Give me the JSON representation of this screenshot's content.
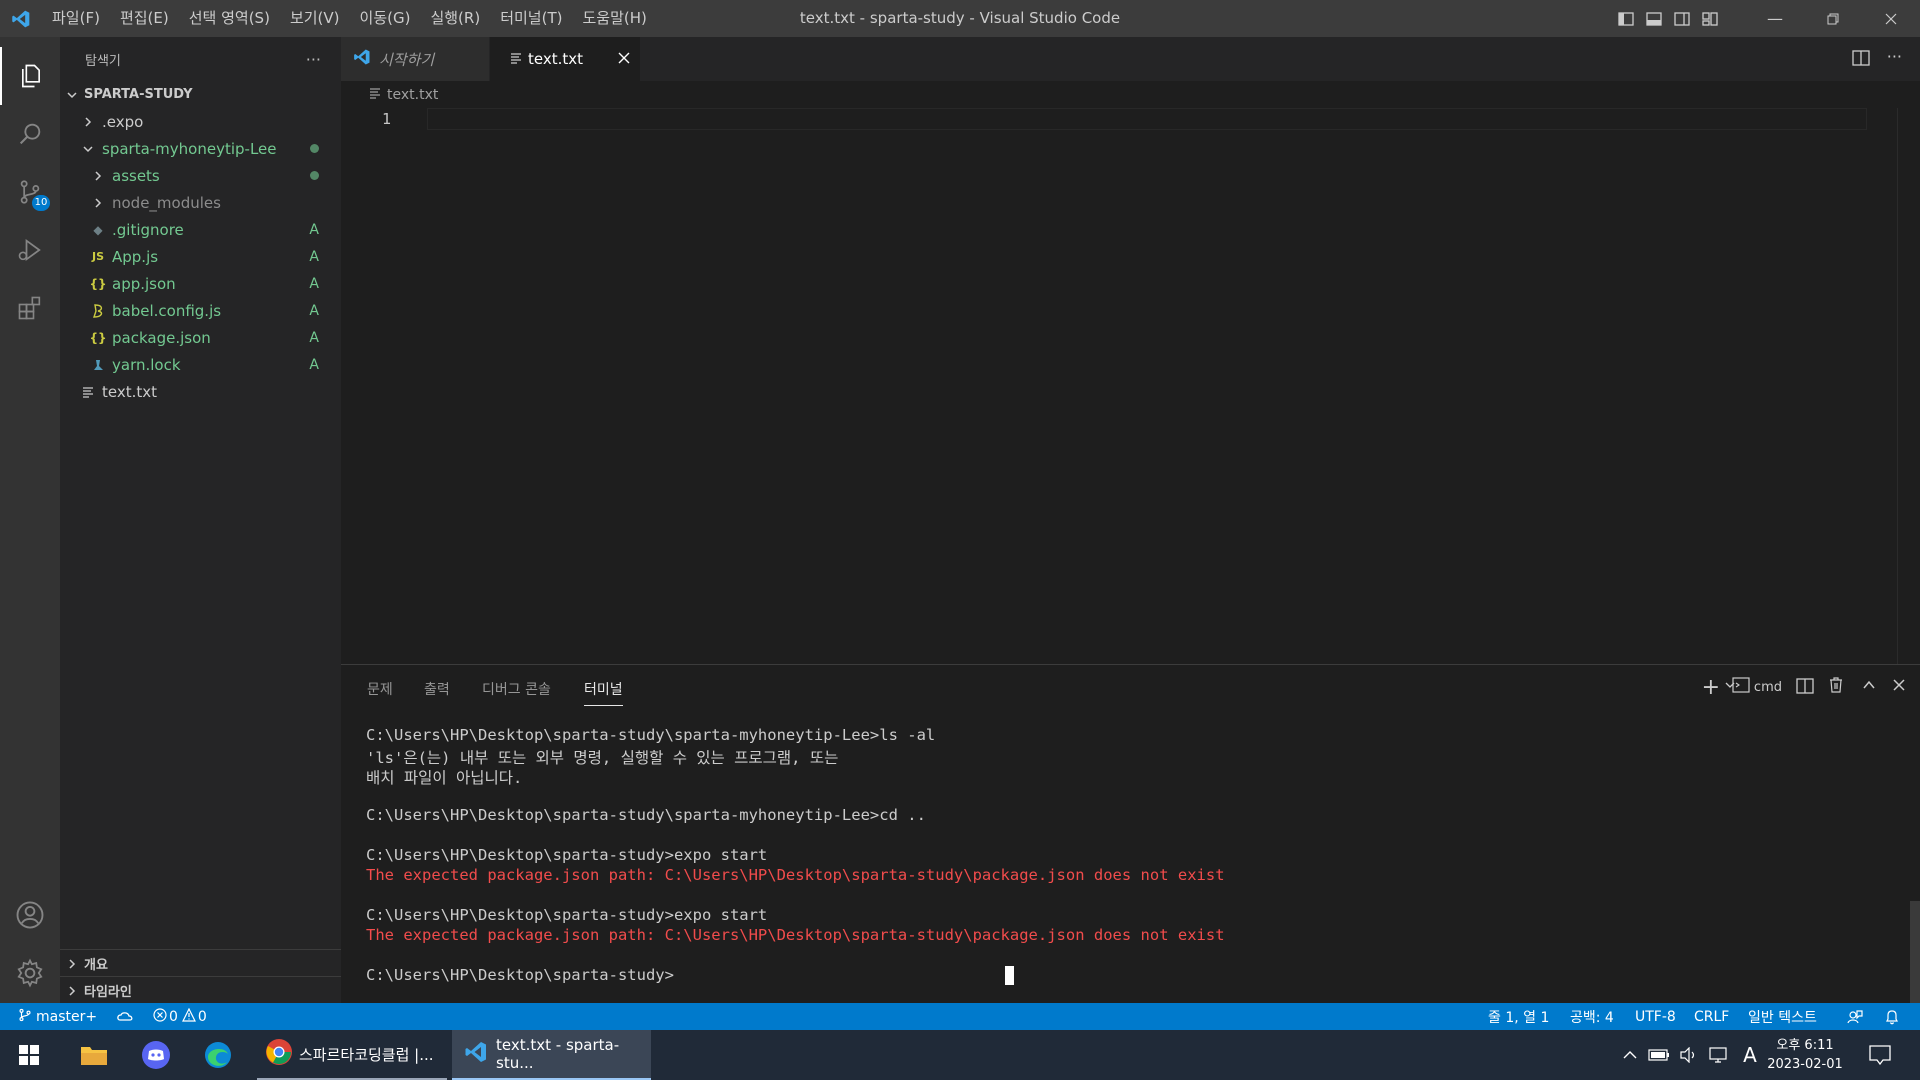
{
  "window": {
    "title": "text.txt - sparta-study - Visual Studio Code",
    "menu": [
      "파일(F)",
      "편집(E)",
      "선택 영역(S)",
      "보기(V)",
      "이동(G)",
      "실행(R)",
      "터미널(T)",
      "도움말(H)"
    ]
  },
  "activity_bar": {
    "scm_badge": "10"
  },
  "sidebar": {
    "header": "탐색기",
    "more": "···",
    "root": "SPARTA-STUDY",
    "tree": [
      {
        "label": ".expo"
      },
      {
        "label": "sparta-myhoneytip-Lee"
      },
      {
        "label": "assets"
      },
      {
        "label": "node_modules"
      },
      {
        "label": ".gitignore",
        "status": "A"
      },
      {
        "label": "App.js",
        "status": "A",
        "icon_text": "JS"
      },
      {
        "label": "app.json",
        "status": "A",
        "icon_text": "{}"
      },
      {
        "label": "babel.config.js",
        "status": "A"
      },
      {
        "label": "package.json",
        "status": "A",
        "icon_text": "{}"
      },
      {
        "label": "yarn.lock",
        "status": "A"
      },
      {
        "label": "text.txt"
      }
    ],
    "outline": "개요",
    "timeline": "타임라인"
  },
  "tabs": [
    {
      "label": "시작하기"
    },
    {
      "label": "text.txt"
    }
  ],
  "breadcrumb": "text.txt",
  "editor": {
    "line_number": "1"
  },
  "panel": {
    "tabs": [
      "문제",
      "출력",
      "디버그 콘솔",
      "터미널"
    ],
    "terminal_name": "cmd",
    "lines": [
      {
        "text": "C:\\Users\\HP\\Desktop\\sparta-study\\sparta-myhoneytip-Lee>ls -al",
        "err": false
      },
      {
        "text": "'ls'은(는) 내부 또는 외부 명령, 실행할 수 있는 프로그램, 또는",
        "err": false
      },
      {
        "text": "배치 파일이 아닙니다.",
        "err": false
      },
      {
        "text": "",
        "err": false
      },
      {
        "text": "C:\\Users\\HP\\Desktop\\sparta-study\\sparta-myhoneytip-Lee>cd ..",
        "err": false
      },
      {
        "text": "",
        "err": false
      },
      {
        "text": "C:\\Users\\HP\\Desktop\\sparta-study>expo start",
        "err": false
      },
      {
        "text": "The expected package.json path: C:\\Users\\HP\\Desktop\\sparta-study\\package.json does not exist",
        "err": true
      },
      {
        "text": "",
        "err": false
      },
      {
        "text": "C:\\Users\\HP\\Desktop\\sparta-study>expo start",
        "err": false
      },
      {
        "text": "The expected package.json path: C:\\Users\\HP\\Desktop\\sparta-study\\package.json does not exist",
        "err": true
      },
      {
        "text": "",
        "err": false
      },
      {
        "text": "C:\\Users\\HP\\Desktop\\sparta-study>",
        "err": false
      }
    ]
  },
  "statusbar": {
    "branch": "master+",
    "errors": "0",
    "warnings": "0",
    "position": "줄 1, 열 1",
    "spaces": "공백: 4",
    "encoding": "UTF-8",
    "eol": "CRLF",
    "language": "일반 텍스트"
  },
  "taskbar": {
    "apps": [
      {
        "label": "스파르타코딩클럽 |..."
      },
      {
        "label": "text.txt - sparta-stu..."
      }
    ],
    "ime": "A",
    "time": "오후 6:11",
    "date": "2023-02-01"
  },
  "colors": {
    "accent": "#007acc",
    "git_added": "#73c991",
    "error": "#f14c4c"
  }
}
